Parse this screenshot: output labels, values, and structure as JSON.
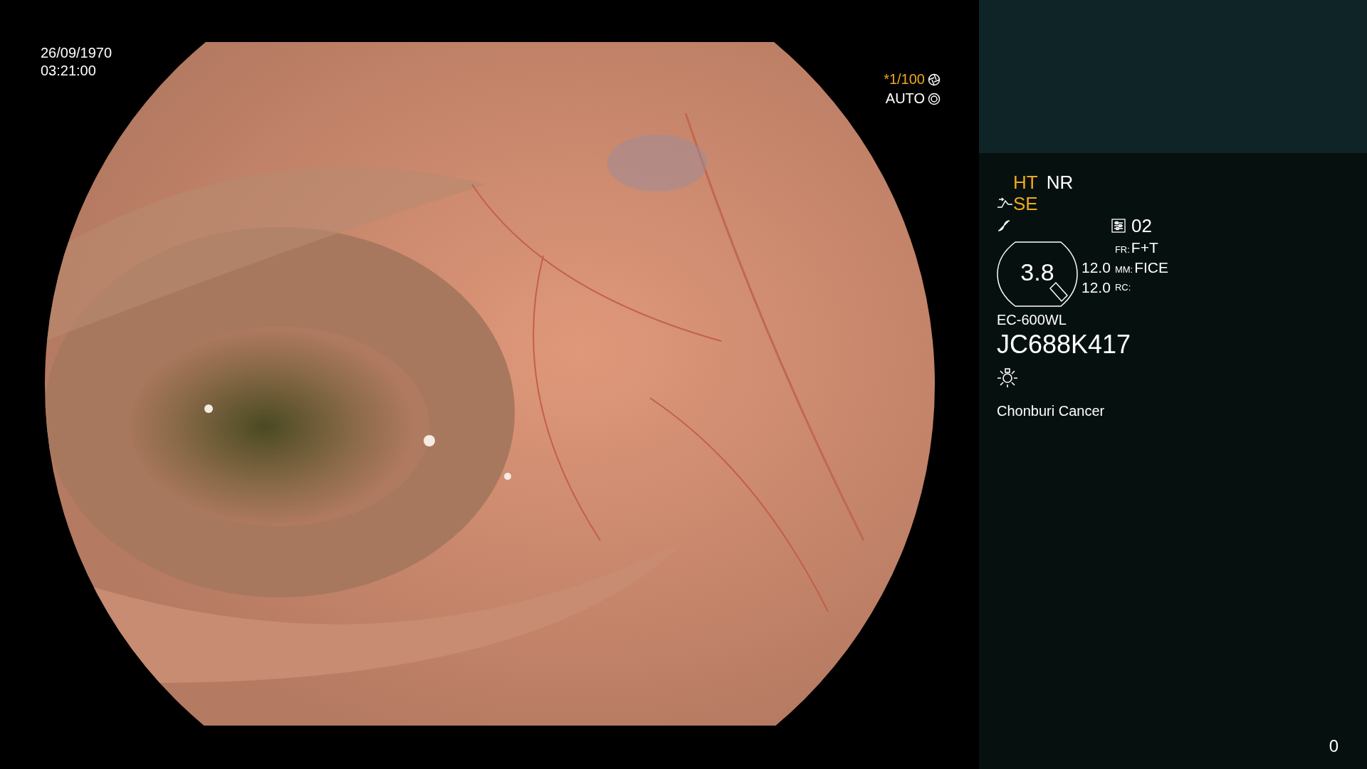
{
  "overlay": {
    "date": "26/09/1970",
    "time": "03:21:00",
    "shutter": {
      "mark": "*",
      "value": "1/100"
    },
    "iris": "AUTO"
  },
  "panel": {
    "indicators": [
      {
        "label": "HT",
        "active": true
      },
      {
        "label": "NR",
        "active": false
      }
    ],
    "enhancement": {
      "label": "SE",
      "active": true
    },
    "preset": "02",
    "zoom": {
      "value": "3.8",
      "readouts": [
        "12.0",
        "12.0"
      ]
    },
    "modes": [
      {
        "key": "FR:",
        "value": "F+T"
      },
      {
        "key": "MM:",
        "value": "FICE"
      },
      {
        "key": "RC:"
      }
    ],
    "scope_model": "EC-600WL",
    "serial": "JC688K417",
    "institution": "Chonburi Cancer",
    "counter": "0"
  }
}
